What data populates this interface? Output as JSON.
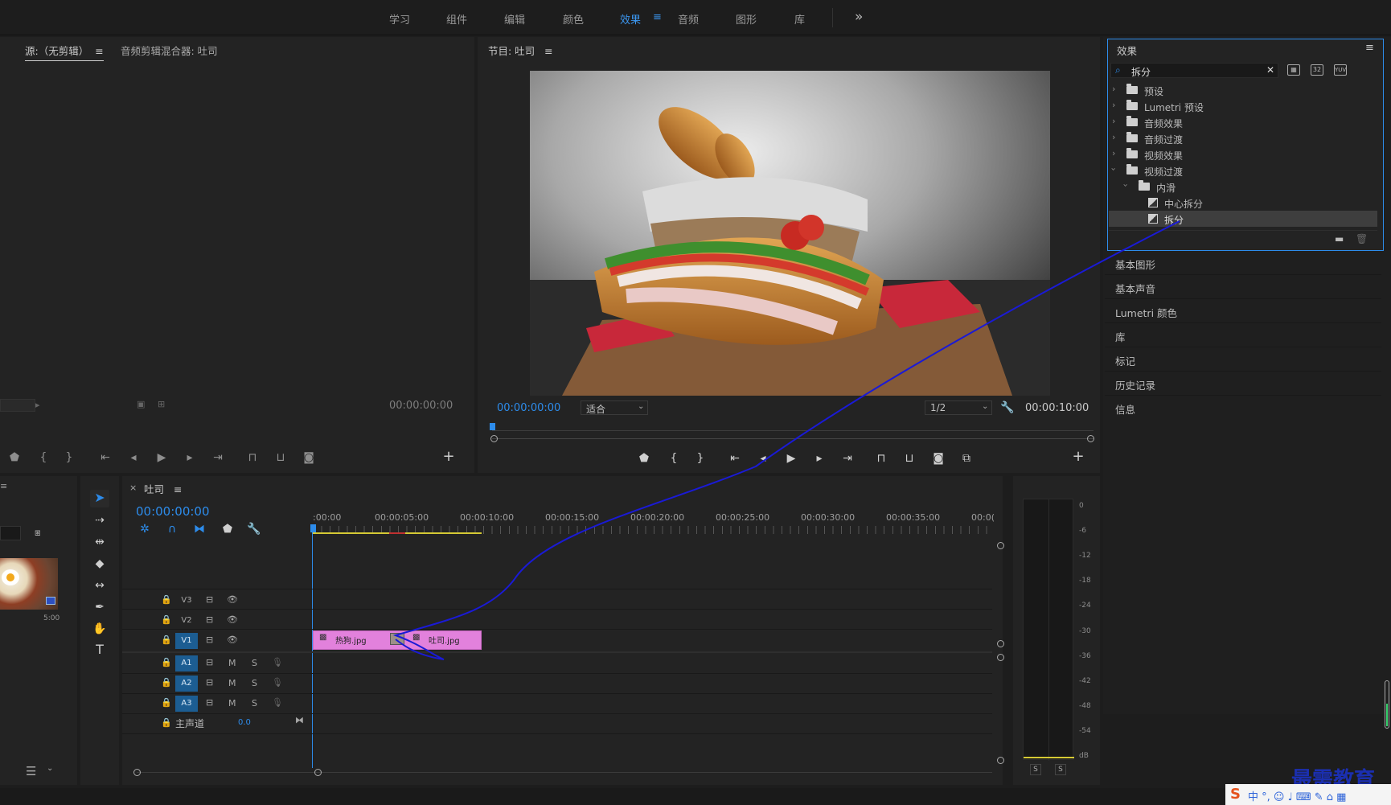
{
  "workspaces": [
    "学习",
    "组件",
    "编辑",
    "颜色",
    "效果",
    "音频",
    "图形",
    "库"
  ],
  "active_workspace": "效果",
  "more_glyph": "»",
  "source_panel": {
    "tab_source": "源:（无剪辑）",
    "tab_audio_mixer": "音频剪辑混合器: 吐司",
    "timecode": "00:00:00:00"
  },
  "program_panel": {
    "title": "节目: 吐司",
    "timecode_current": "00:00:00:00",
    "zoom_select": "适合",
    "resolution_select": "1/2",
    "timecode_duration": "00:00:10:00"
  },
  "effects_panel": {
    "title": "效果",
    "search_value": "拆分",
    "tree": [
      {
        "label": "预设",
        "depth": 0,
        "expanded": false,
        "icon": "preset-folder-icon"
      },
      {
        "label": "Lumetri 预设",
        "depth": 0,
        "expanded": false,
        "icon": "preset-folder-icon"
      },
      {
        "label": "音频效果",
        "depth": 0,
        "expanded": false,
        "icon": "folder-icon"
      },
      {
        "label": "音频过渡",
        "depth": 0,
        "expanded": false,
        "icon": "folder-icon"
      },
      {
        "label": "视频效果",
        "depth": 0,
        "expanded": false,
        "icon": "folder-icon"
      },
      {
        "label": "视频过渡",
        "depth": 0,
        "expanded": true,
        "icon": "folder-icon"
      },
      {
        "label": "内滑",
        "depth": 1,
        "expanded": true,
        "icon": "folder-icon"
      },
      {
        "label": "中心拆分",
        "depth": 2,
        "icon": "transition-icon"
      },
      {
        "label": "拆分",
        "depth": 2,
        "icon": "transition-icon",
        "selected": true
      }
    ]
  },
  "right_panels": [
    "基本图形",
    "基本声音",
    "Lumetri 颜色",
    "库",
    "标记",
    "历史记录",
    "信息"
  ],
  "timeline": {
    "tab_title": "吐司",
    "timecode": "00:00:00:00",
    "ruler_labels": [
      ":00:00",
      "00:00:05:00",
      "00:00:10:00",
      "00:00:15:00",
      "00:00:20:00",
      "00:00:25:00",
      "00:00:30:00",
      "00:00:35:00",
      "00:0("
    ],
    "tracks": [
      {
        "label": "V3",
        "type": "video",
        "on": false
      },
      {
        "label": "V2",
        "type": "video",
        "on": false
      },
      {
        "label": "V1",
        "type": "video",
        "on": true
      },
      {
        "label": "A1",
        "type": "audio",
        "on": true
      },
      {
        "label": "A2",
        "type": "audio",
        "on": true
      },
      {
        "label": "A3",
        "type": "audio",
        "on": true
      }
    ],
    "master_label": "主声道",
    "master_value": "0.0",
    "clips": [
      {
        "name": "热狗.jpg",
        "track": "V1"
      },
      {
        "name": "吐司.jpg",
        "track": "V1"
      }
    ],
    "audio_btn_m": "M",
    "audio_btn_s": "S"
  },
  "project_panel": {
    "thumb_duration": "5:00"
  },
  "audio_meter": {
    "scale": [
      "0",
      "-6",
      "-12",
      "-18",
      "-24",
      "-30",
      "-36",
      "-42",
      "-48",
      "-54",
      "dB"
    ],
    "solo_labels": [
      "S",
      "S"
    ]
  },
  "watermark": "最需教育",
  "ime_bar": "中 °, ☺ ♩ ⌨ ✎ ⌂ ▦",
  "colors": {
    "accent": "#2d8ceb",
    "clip": "#e281dc",
    "annotation_line": "#1a1ad6",
    "work_area": "#d5c934"
  }
}
